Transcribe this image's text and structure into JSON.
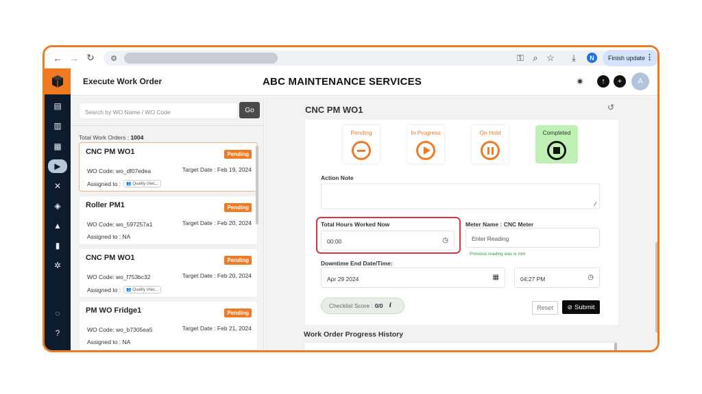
{
  "browser": {
    "finish_update_label": "Finish update",
    "profile_initial": "N"
  },
  "app": {
    "section_title": "Execute Work Order",
    "company_name": "ABC MAINTENANCE SERVICES",
    "user_initial": "A",
    "accent": "#f07a22",
    "sidebar_bg": "#0e1b2c"
  },
  "left": {
    "search_placeholder": "Search by WO Name / WO Code",
    "go_label": "Go",
    "total_label": "Total Work Orders :",
    "total_value": "1004",
    "cards": [
      {
        "title": "CNC PM WO1",
        "status": "Pending",
        "wo_code": "WO Code: wo_df07edea",
        "target": "Target Date : Feb 19, 2024",
        "assigned_label": "Assigned to :",
        "assigned": "Quality chec..."
      },
      {
        "title": "Roller PM1",
        "status": "Pending",
        "wo_code": "WO Code: wo_597257a1",
        "target": "Target Date : Feb 20, 2024",
        "assigned_label": "Assigned to :",
        "assigned": "NA"
      },
      {
        "title": "CNC PM WO1",
        "status": "Pending",
        "wo_code": "WO Code: wo_f753bc32",
        "target": "Target Date : Feb 20, 2024",
        "assigned_label": "Assigned to :",
        "assigned": "Quality chec..."
      },
      {
        "title": "PM WO Fridge1",
        "status": "Pending",
        "wo_code": "WO Code: wo_b7305ea5",
        "target": "Target Date : Feb 21, 2024",
        "assigned_label": "Assigned to :",
        "assigned": "NA"
      }
    ]
  },
  "detail": {
    "title": "CNC PM WO1",
    "statuses": [
      {
        "label": "Pending"
      },
      {
        "label": "In Progress"
      },
      {
        "label": "On Hold"
      },
      {
        "label": "Completed"
      }
    ],
    "action_note_label": "Action Note",
    "hours_label": "Total Hours Worked Now",
    "hours_value": "00:00",
    "meter_label": "Meter Name : CNC Meter",
    "meter_placeholder": "Enter Reading",
    "previous_reading": "Previous reading was w mm",
    "downtime_label": "Downtime End Date/Time:",
    "downtime_date": "Apr 29 2024",
    "downtime_time": "04:27 PM",
    "checklist_label": "Checklist Score :",
    "checklist_value": "0/0",
    "reset_label": "Reset",
    "submit_label": "Submit",
    "history_title": "Work Order Progress History"
  }
}
